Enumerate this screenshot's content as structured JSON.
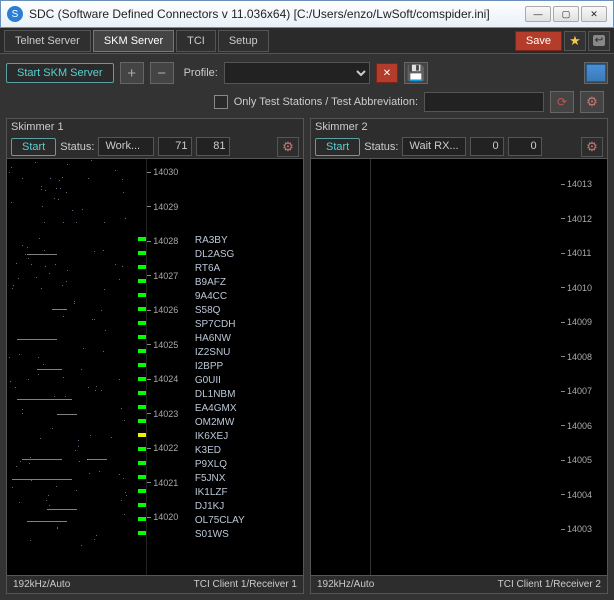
{
  "window": {
    "title": "SDC (Software Defined Connectors v 11.036x64) [C:/Users/enzo/LwSoft/comspider.ini]"
  },
  "tabs": {
    "telnet": "Telnet Server",
    "skm": "SKM Server",
    "tci": "TCI",
    "setup": "Setup",
    "save": "Save"
  },
  "toolbar": {
    "start_skm": "Start SKM Server",
    "profile_label": "Profile:",
    "test_label": "Only Test Stations / Test Abbreviation:"
  },
  "skimmer1": {
    "title": "Skimmer 1",
    "start": "Start",
    "status_label": "Status:",
    "status_value": "Work...",
    "num1": "71",
    "num2": "81",
    "foot_left": "192kHz/Auto",
    "foot_right": "TCI Client 1/Receiver 1",
    "scale_ticks": [
      "14030",
      "14029",
      "14028",
      "14027",
      "14026",
      "14025",
      "14024",
      "14023",
      "14022",
      "14021",
      "14020"
    ],
    "callsigns": [
      "RA3BY",
      "DL2ASG",
      "RT6A",
      "B9AFZ",
      "9A4CC",
      "S58Q",
      "SP7CDH",
      "HA6NW",
      "IZ2SNU",
      "I2BPP",
      "G0UII",
      "DL1NBM",
      "EA4GMX",
      "OM2MW",
      "IK6XEJ",
      "K3ED",
      "P9XLQ",
      "F5JNX",
      "IK1LZF",
      "DJ1KJ",
      "OL75CLAY",
      "S01WS"
    ]
  },
  "skimmer2": {
    "title": "Skimmer 2",
    "start": "Start",
    "status_label": "Status:",
    "status_value": "Wait RX...",
    "num1": "0",
    "num2": "0",
    "foot_left": "192kHz/Auto",
    "foot_right": "TCI Client 1/Receiver 2",
    "scale_ticks": [
      "14013",
      "14012",
      "14011",
      "14010",
      "14009",
      "14008",
      "14007",
      "14006",
      "14005",
      "14004",
      "14003"
    ]
  }
}
